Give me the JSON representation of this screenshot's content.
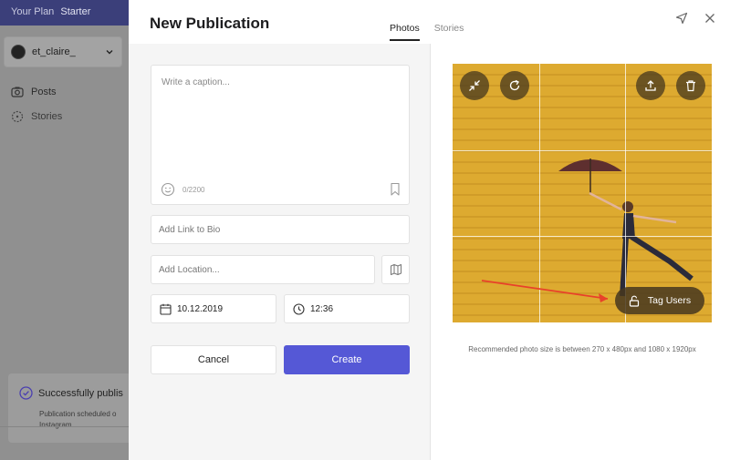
{
  "app": {
    "plan_label": "Your Plan",
    "plan_name": "Starter",
    "account_name": "et_claire_",
    "nav": [
      {
        "label": "Posts",
        "icon": "camera-icon"
      },
      {
        "label": "Stories",
        "icon": "stories-icon"
      }
    ],
    "toast": {
      "title": "Successfully publis",
      "body_line1": "Publication scheduled o",
      "body_line2": "Instagram",
      "icon": "check-circle-icon"
    }
  },
  "modal": {
    "title": "New Publication",
    "tabs": [
      {
        "label": "Photos",
        "active": true
      },
      {
        "label": "Stories",
        "active": false
      }
    ],
    "caption": {
      "placeholder": "Write a caption...",
      "char_count": "0/2200"
    },
    "link_field": {
      "placeholder": "Add Link to Bio"
    },
    "location_field": {
      "placeholder": "Add Location..."
    },
    "date": "10.12.2019",
    "time": "12:36",
    "cancel_label": "Cancel",
    "create_label": "Create",
    "tag_users_label": "Tag Users",
    "recommendation": "Recommended photo size is between 270 x 480px and 1080 x 1920px"
  },
  "colors": {
    "accent": "#5558d6",
    "plan_bar": "#3b3f7a",
    "photo_background": "#ddaa30"
  }
}
